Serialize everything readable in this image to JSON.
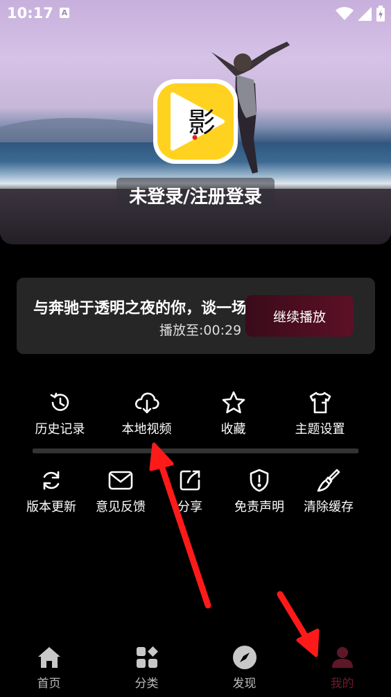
{
  "status_bar": {
    "time": "10:17",
    "notify_letter": "A"
  },
  "header": {
    "logo_char": "影",
    "login_label": "未登录/注册登录"
  },
  "continue_card": {
    "title": "与奔驰于透明之夜的你，谈一场不可能的恋",
    "progress": "播放至:00:29",
    "continue_label": "继续播放"
  },
  "menu_primary": [
    {
      "label": "历史记录",
      "icon": "history-icon"
    },
    {
      "label": "本地视频",
      "icon": "cloud-download-icon"
    },
    {
      "label": "收藏",
      "icon": "star-icon"
    },
    {
      "label": "主题设置",
      "icon": "shirt-icon"
    }
  ],
  "menu_secondary": [
    {
      "label": "版本更新",
      "icon": "refresh-icon"
    },
    {
      "label": "意见反馈",
      "icon": "mail-icon"
    },
    {
      "label": "分享",
      "icon": "share-icon"
    },
    {
      "label": "免责声明",
      "icon": "shield-icon"
    },
    {
      "label": "清除缓存",
      "icon": "brush-icon"
    }
  ],
  "bottom_nav": [
    {
      "label": "首页",
      "icon": "home-icon"
    },
    {
      "label": "分类",
      "icon": "category-icon"
    },
    {
      "label": "发现",
      "icon": "compass-icon"
    },
    {
      "label": "我的",
      "icon": "user-icon",
      "active": true
    }
  ],
  "colors": {
    "accent": "#6c1c2c",
    "annotation": "#ff1a1a",
    "logo_yellow": "#ffd21f"
  }
}
